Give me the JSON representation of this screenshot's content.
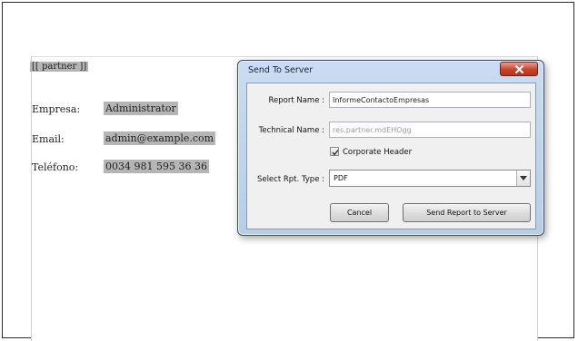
{
  "document": {
    "tag": "[[ partner ]]",
    "rows": [
      {
        "label": "Empresa:",
        "value": "Administrator"
      },
      {
        "label": "Email:",
        "value": "admin@example.com"
      },
      {
        "label": "Teléfono:",
        "value": "0034 981 595 36 36"
      }
    ]
  },
  "dialog": {
    "title": "Send To Server",
    "report_name_label": "Report Name :",
    "report_name_value": "InformeContactoEmpresas",
    "technical_name_label": "Technical Name :",
    "technical_name_value": "res.partner.mdEHOgg",
    "corporate_header_label": "Corporate Header",
    "corporate_header_checked": true,
    "report_type_label": "Select Rpt. Type :",
    "report_type_value": "PDF",
    "cancel_label": "Cancel",
    "send_label": "Send Report to Server"
  },
  "icons": {
    "close": "close-icon",
    "check": "check-icon",
    "dropdown": "chevron-down-icon"
  },
  "colors": {
    "dialog_frame": "#b7cde8",
    "close_button": "#c8432c",
    "field_highlight": "#b5b5b5"
  }
}
